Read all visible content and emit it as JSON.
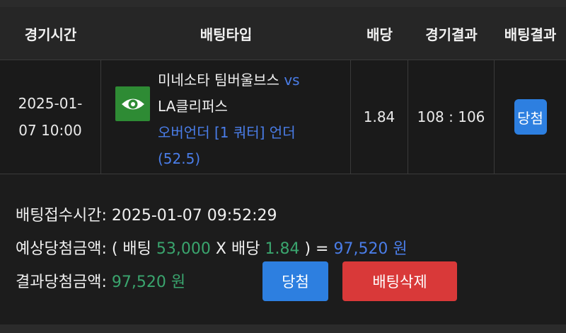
{
  "table": {
    "headers": {
      "time": "경기시간",
      "bet_type": "배팅타입",
      "odds": "배당",
      "game_result": "경기결과",
      "bet_result": "배팅결과"
    },
    "row": {
      "time_line1": "2025-01-",
      "time_line2": "07 10:00",
      "home_team": "미네소타 팀버울브스",
      "vs": "vs",
      "away_team": "LA클리퍼스",
      "market_line1": "오버언더 [1 쿼터] 언더",
      "market_line2": "(52.5)",
      "odds": "1.84",
      "score": "108 : 106",
      "result_badge": "당첨",
      "icon": "eye-icon",
      "icon_bg": "#2e8b34"
    }
  },
  "summary": {
    "accept_time_label": "배팅접수시간:",
    "accept_time_value": "2025-01-07 09:52:29",
    "expected_label": "예상당첨금액:",
    "expected_open": "( 배팅",
    "stake": "53,000",
    "x_label": "X 배당",
    "expected_odds": "1.84",
    "close_eq": ") =",
    "expected_amount": "97,520 원",
    "result_label": "결과당첨금액:",
    "result_amount": "97,520 원"
  },
  "buttons": {
    "win_label": "당첨",
    "delete_label": "배팅삭제"
  },
  "colors": {
    "background": "#1c1c1c",
    "accent_blue": "#2d7fe0",
    "accent_green": "#3aa56e",
    "delete_red": "#d93939"
  }
}
